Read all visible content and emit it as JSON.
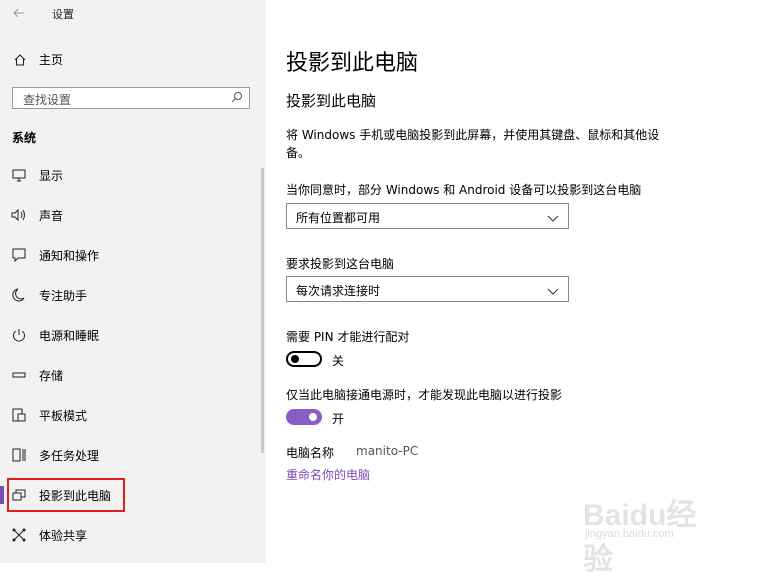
{
  "window": {
    "title": "设置"
  },
  "sidebar": {
    "home_label": "主页",
    "search_placeholder": "查找设置",
    "section_label": "系统",
    "items": [
      {
        "label": "显示",
        "icon": "monitor-icon"
      },
      {
        "label": "声音",
        "icon": "speaker-icon"
      },
      {
        "label": "通知和操作",
        "icon": "notification-icon"
      },
      {
        "label": "专注助手",
        "icon": "moon-icon"
      },
      {
        "label": "电源和睡眠",
        "icon": "power-icon"
      },
      {
        "label": "存储",
        "icon": "storage-icon"
      },
      {
        "label": "平板模式",
        "icon": "tablet-icon"
      },
      {
        "label": "多任务处理",
        "icon": "multitask-icon"
      },
      {
        "label": "投影到此电脑",
        "icon": "project-icon",
        "active": true
      },
      {
        "label": "体验共享",
        "icon": "share-icon"
      }
    ]
  },
  "main": {
    "title": "投影到此电脑",
    "subtitle": "投影到此电脑",
    "description": "将 Windows 手机或电脑投影到此屏幕，并使用其键盘、鼠标和其他设备。",
    "agree_label": "当你同意时，部分 Windows 和 Android 设备可以投影到这台电脑",
    "agree_value": "所有位置都可用",
    "request_label": "要求投影到这台电脑",
    "request_value": "每次请求连接时",
    "pin_label": "需要 PIN 才能进行配对",
    "pin_state": "关",
    "power_label": "仅当此电脑接通电源时，才能发现此电脑以进行投影",
    "power_state": "开",
    "pc_name_label": "电脑名称",
    "pc_name_value": "manito-PC",
    "rename_link": "重命名你的电脑"
  },
  "watermark": {
    "main": "Baidu经验",
    "sub": "jingyan.baidu.com"
  },
  "colors": {
    "accent": "#7b4db6",
    "highlight_box": "#e0201c",
    "sidebar_bg": "#f2f2f2"
  }
}
